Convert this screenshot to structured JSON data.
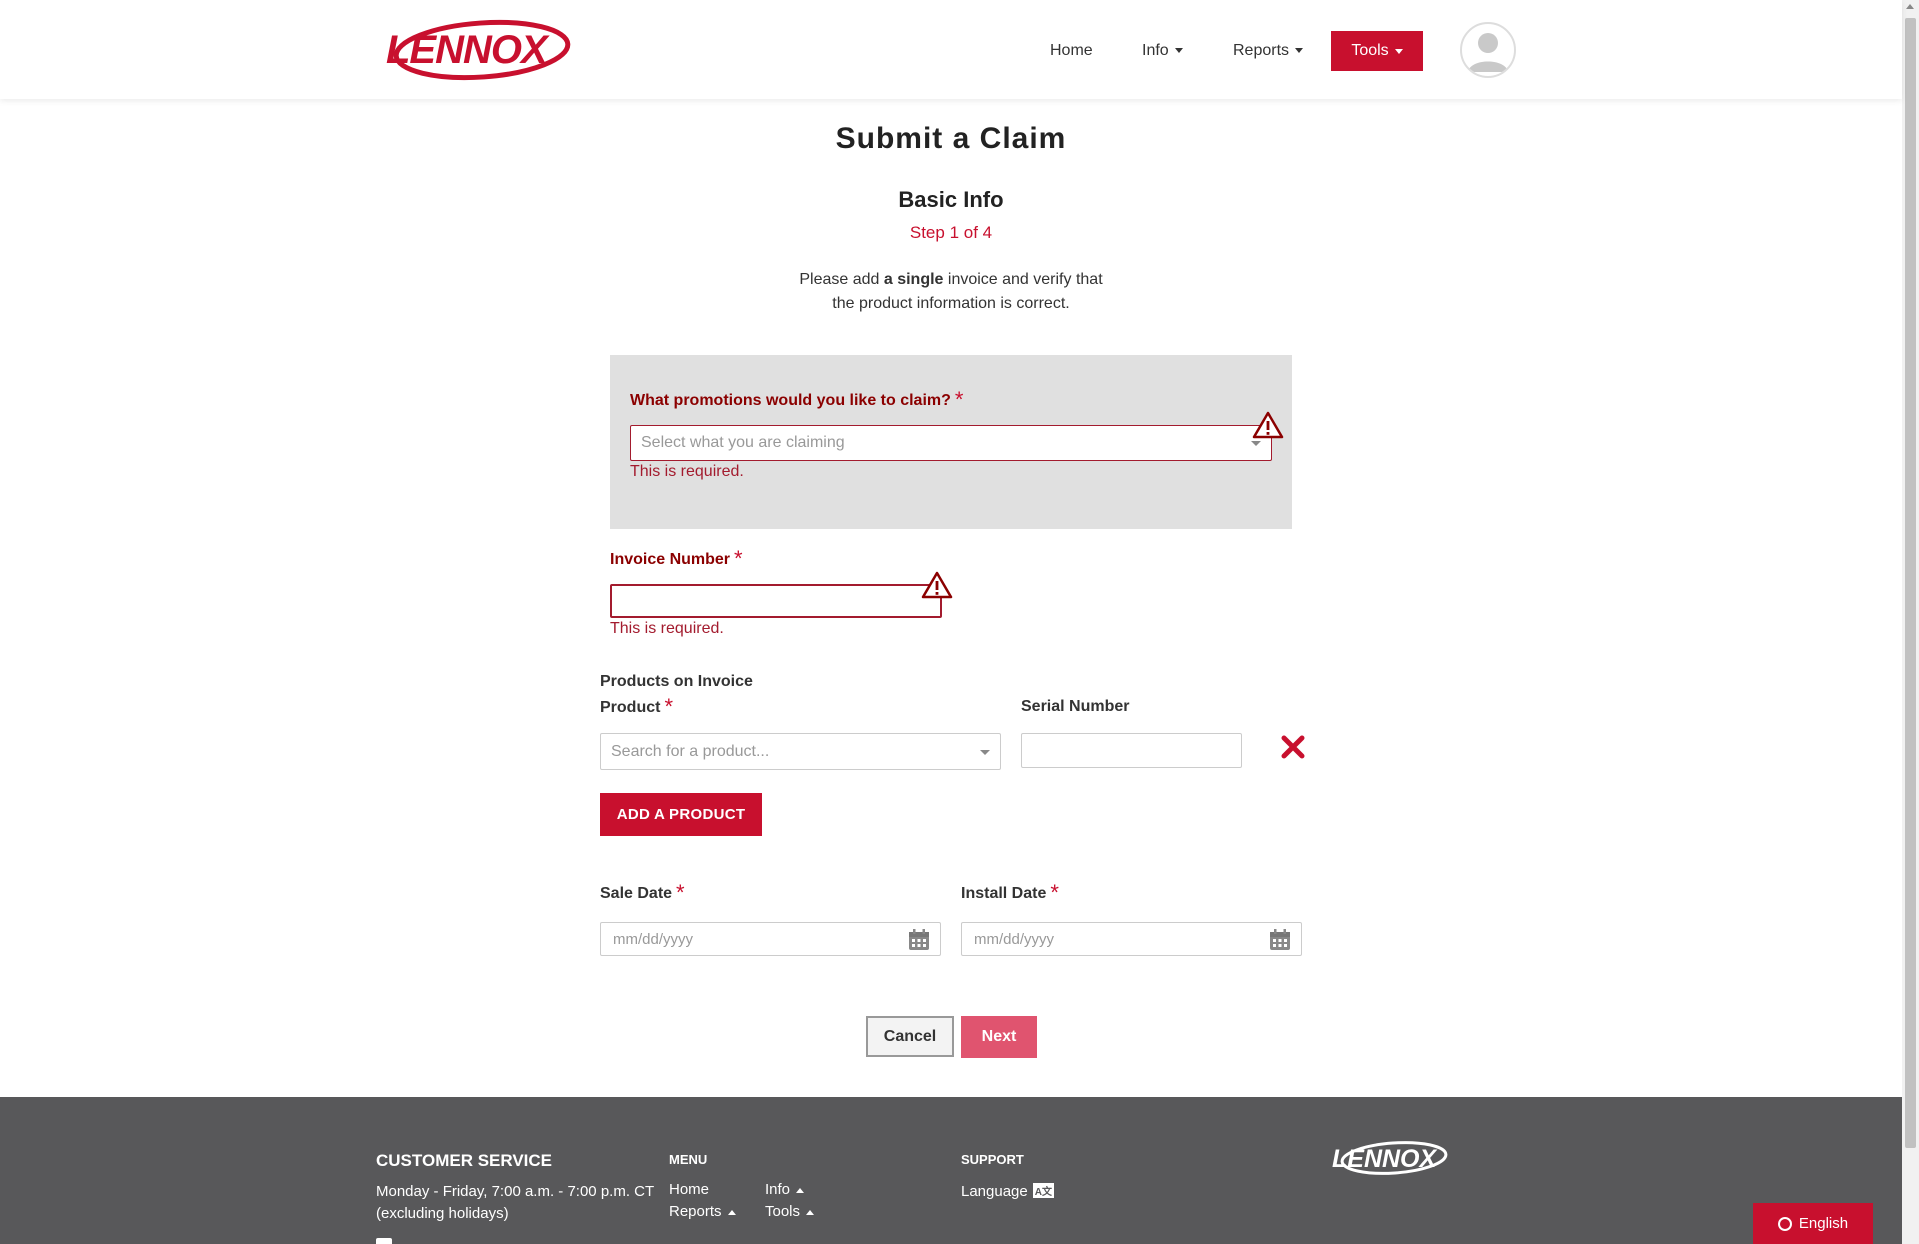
{
  "header": {
    "logo_text": "LENNOX",
    "nav": {
      "home": "Home",
      "info": "Info",
      "reports": "Reports",
      "tools": "Tools"
    }
  },
  "main": {
    "title": "Submit a Claim",
    "section": "Basic Info",
    "step": "Step 1 of 4",
    "instructions": {
      "before": "Please add ",
      "bold": "a single",
      "after": " invoice and verify that",
      "line2": "the product information is correct."
    },
    "promotions": {
      "label": "What promotions would you like to claim?",
      "required_mark": "*",
      "placeholder": "Select what you are claiming",
      "error": "This is required."
    },
    "invoice": {
      "label": "Invoice Number",
      "required_mark": "*",
      "value": "",
      "error": "This is required."
    },
    "products": {
      "heading": "Products on Invoice",
      "product_label": "Product",
      "required_mark": "*",
      "product_placeholder": "Search for a product...",
      "serial_label": "Serial Number",
      "serial_value": "",
      "add_button": "ADD A PRODUCT"
    },
    "sale_date": {
      "label": "Sale Date",
      "required_mark": "*",
      "placeholder": "mm/dd/yyyy"
    },
    "install_date": {
      "label": "Install Date",
      "required_mark": "*",
      "placeholder": "mm/dd/yyyy"
    },
    "buttons": {
      "cancel": "Cancel",
      "next": "Next"
    }
  },
  "footer": {
    "customer_service": {
      "heading": "CUSTOMER SERVICE",
      "hours_line1": "Monday - Friday, 7:00 a.m. - 7:00 p.m. CT",
      "hours_line2": "(excluding holidays)"
    },
    "menu": {
      "heading": "MENU",
      "home": "Home",
      "info": "Info",
      "reports": "Reports",
      "tools": "Tools"
    },
    "support": {
      "heading": "SUPPORT",
      "language": "Language",
      "language_badge": "A文"
    },
    "logo_text": "LENNOX"
  },
  "language_button": "English",
  "colors": {
    "brand_red": "#c8102e",
    "error_red": "#a31b2e",
    "next_pink": "#e0546f",
    "footer_gray": "#58585a",
    "panel_gray": "#e0e0e0"
  }
}
